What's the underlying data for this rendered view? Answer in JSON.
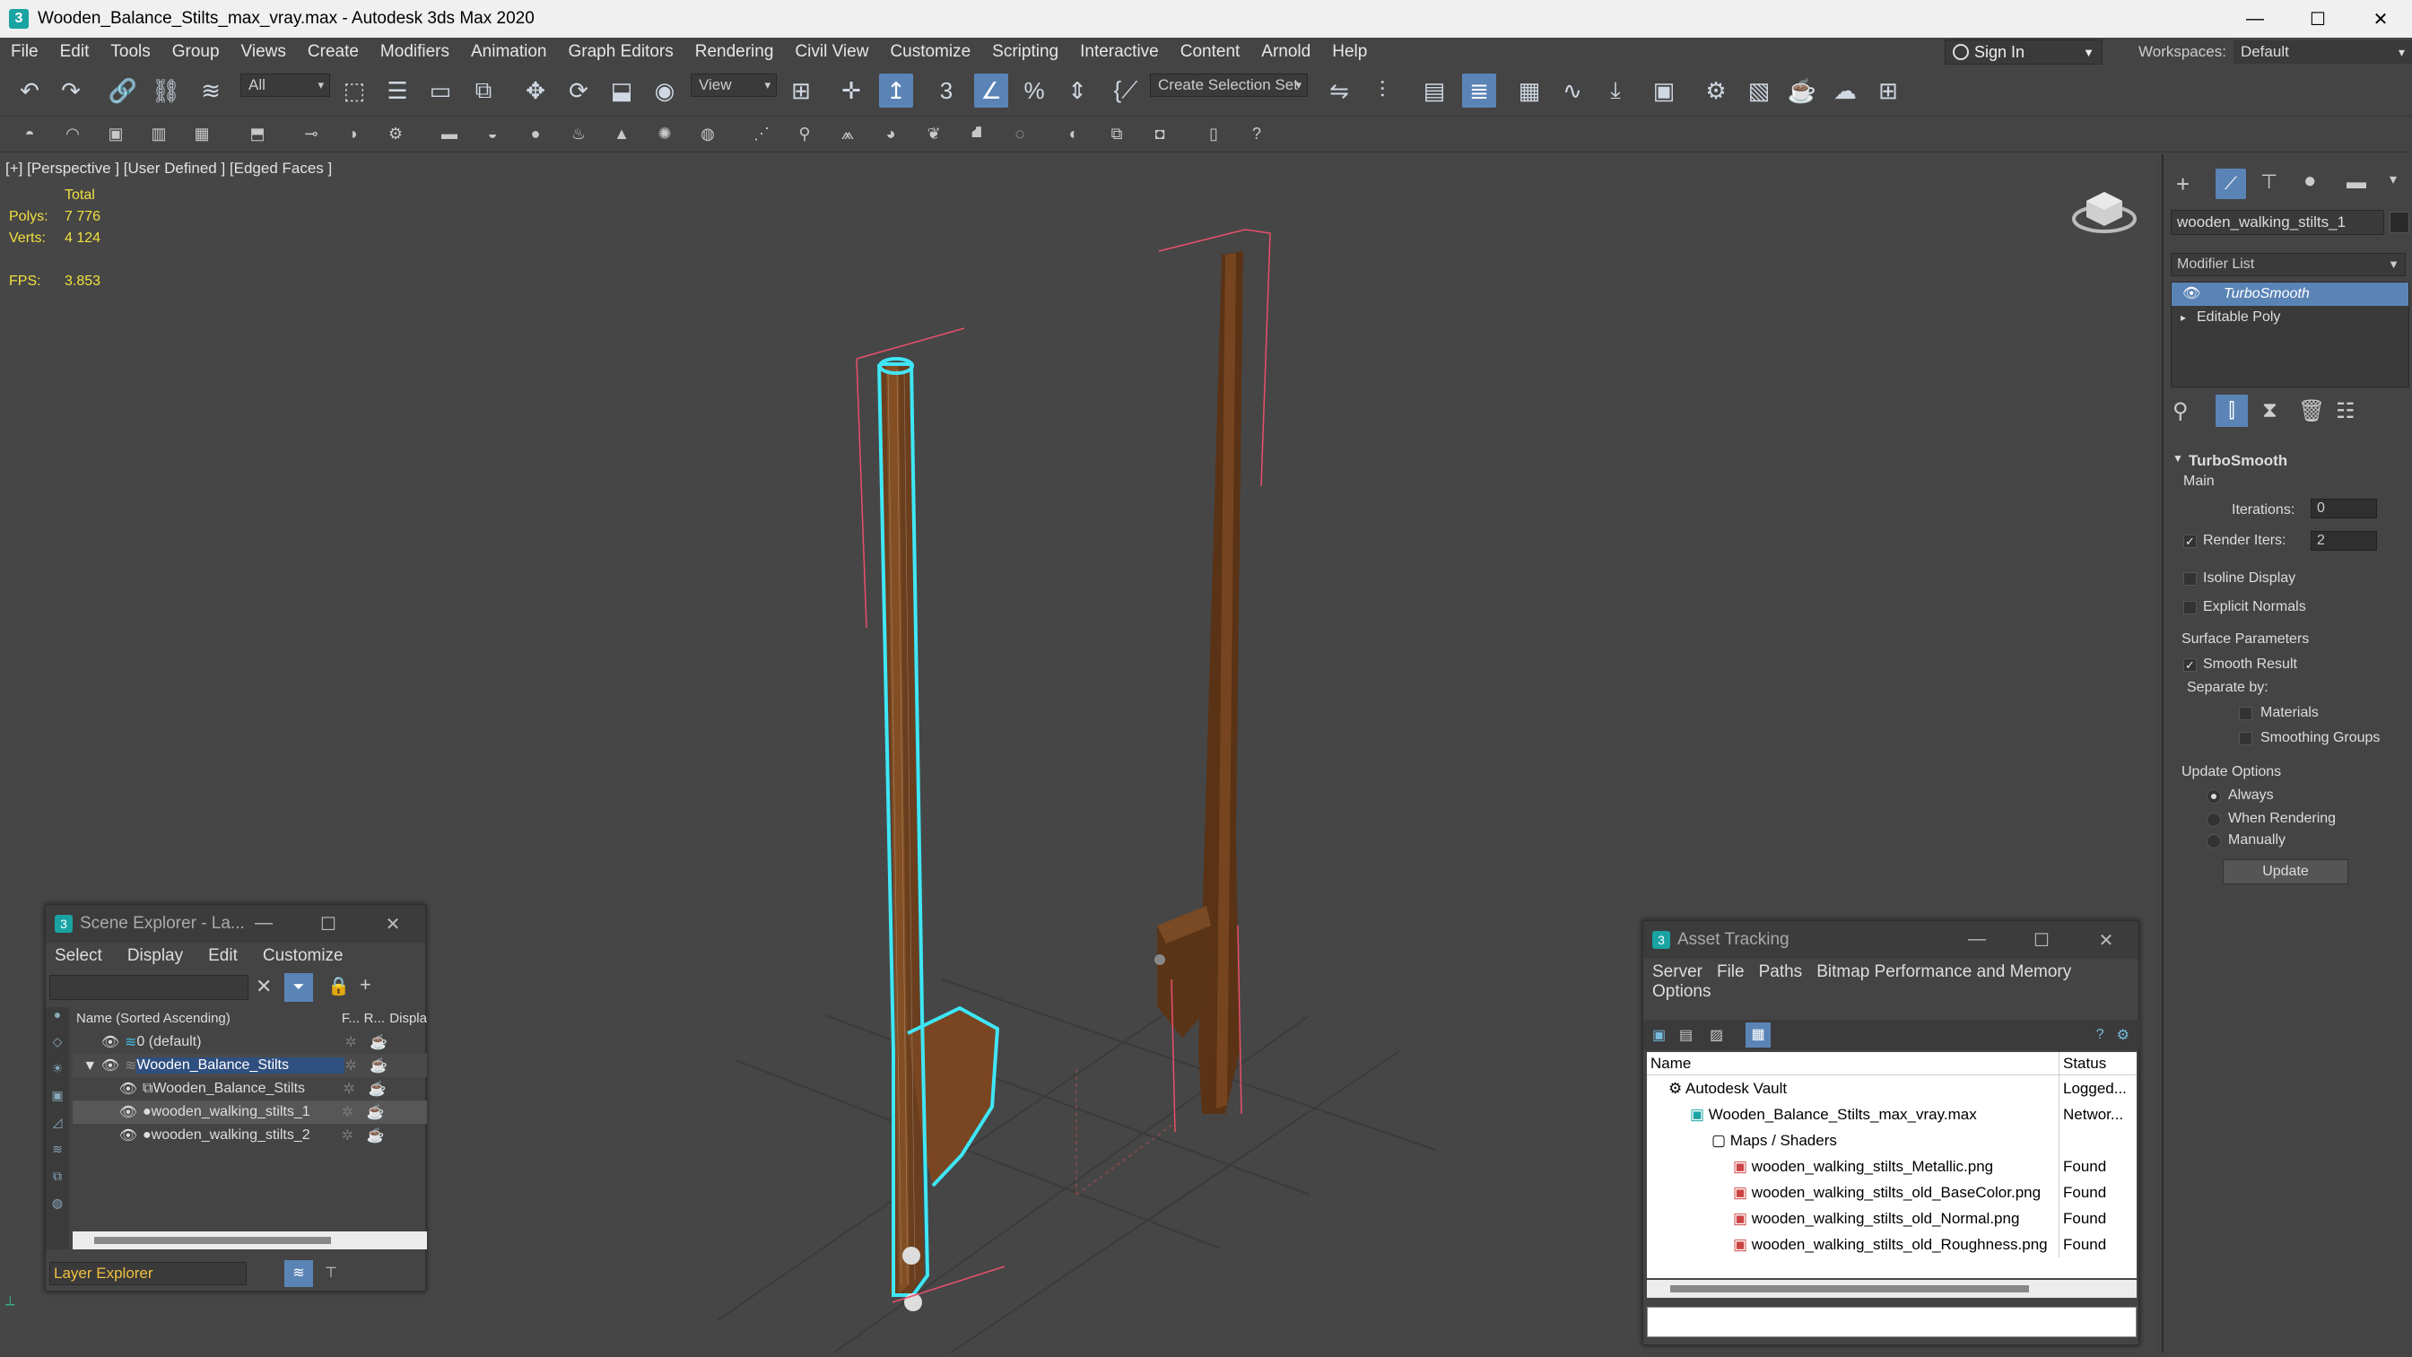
{
  "window": {
    "title": "Wooden_Balance_Stilts_max_vray.max - Autodesk 3ds Max 2020",
    "app_icon": "3"
  },
  "menu": [
    "File",
    "Edit",
    "Tools",
    "Group",
    "Views",
    "Create",
    "Modifiers",
    "Animation",
    "Graph Editors",
    "Rendering",
    "Civil View",
    "Customize",
    "Scripting",
    "Interactive",
    "Content",
    "Arnold",
    "Help"
  ],
  "account": {
    "signin_label": "Sign In",
    "workspaces_label": "Workspaces:",
    "workspace_value": "Default"
  },
  "toolbar": {
    "filter_value": "All",
    "refcoord_value": "View",
    "selection_set_value": "Create Selection Set",
    "snap_label": "3"
  },
  "viewport": {
    "label": "[+] [Perspective ] [User Defined ] [Edged Faces ]",
    "stats_header": "Total",
    "polys_label": "Polys:",
    "polys_value": "7 776",
    "verts_label": "Verts:",
    "verts_value": "4 124",
    "fps_label": "FPS:",
    "fps_value": "3.853"
  },
  "command_panel": {
    "object_name": "wooden_walking_stilts_1",
    "modifier_list_label": "Modifier List",
    "stack": [
      "TurboSmooth",
      "Editable Poly"
    ],
    "rollout_title": "TurboSmooth",
    "main_label": "Main",
    "iterations_label": "Iterations:",
    "iterations_value": "0",
    "render_iters_label": "Render Iters:",
    "render_iters_value": "2",
    "isoline_label": "Isoline Display",
    "explicit_normals_label": "Explicit Normals",
    "surface_params_label": "Surface Parameters",
    "smooth_result_label": "Smooth Result",
    "separate_by_label": "Separate by:",
    "materials_label": "Materials",
    "smoothing_groups_label": "Smoothing Groups",
    "update_options_label": "Update Options",
    "always_label": "Always",
    "when_rendering_label": "When Rendering",
    "manually_label": "Manually",
    "update_button": "Update"
  },
  "scene_explorer": {
    "title": "Scene Explorer - La...",
    "menu": [
      "Select",
      "Display",
      "Edit",
      "Customize"
    ],
    "col_name": "Name (Sorted Ascending)",
    "col_f": "F...",
    "col_r": "R...",
    "col_display": "Displa",
    "rows": [
      {
        "name": "0 (default)",
        "indent": 0
      },
      {
        "name": "Wooden_Balance_Stilts",
        "indent": 0
      },
      {
        "name": "Wooden_Balance_Stilts",
        "indent": 1
      },
      {
        "name": "wooden_walking_stilts_1",
        "indent": 1
      },
      {
        "name": "wooden_walking_stilts_2",
        "indent": 1
      }
    ],
    "footer_label": "Layer Explorer"
  },
  "asset_tracking": {
    "title": "Asset Tracking",
    "menu": [
      "Server",
      "File",
      "Paths",
      "Bitmap Performance and Memory"
    ],
    "menu2": "Options",
    "col_name": "Name",
    "col_status": "Status",
    "rows": [
      {
        "name": "Autodesk Vault",
        "status": "Logged..."
      },
      {
        "name": "Wooden_Balance_Stilts_max_vray.max",
        "status": "Networ..."
      },
      {
        "name": "Maps / Shaders",
        "status": ""
      },
      {
        "name": "wooden_walking_stilts_Metallic.png",
        "status": "Found"
      },
      {
        "name": "wooden_walking_stilts_old_BaseColor.png",
        "status": "Found"
      },
      {
        "name": "wooden_walking_stilts_old_Normal.png",
        "status": "Found"
      },
      {
        "name": "wooden_walking_stilts_old_Roughness.png",
        "status": "Found"
      }
    ]
  },
  "colors": {
    "selection_blue": "#5b84b6",
    "stats_yellow": "#f0e040",
    "wire_cyan": "#3fe6f5"
  }
}
